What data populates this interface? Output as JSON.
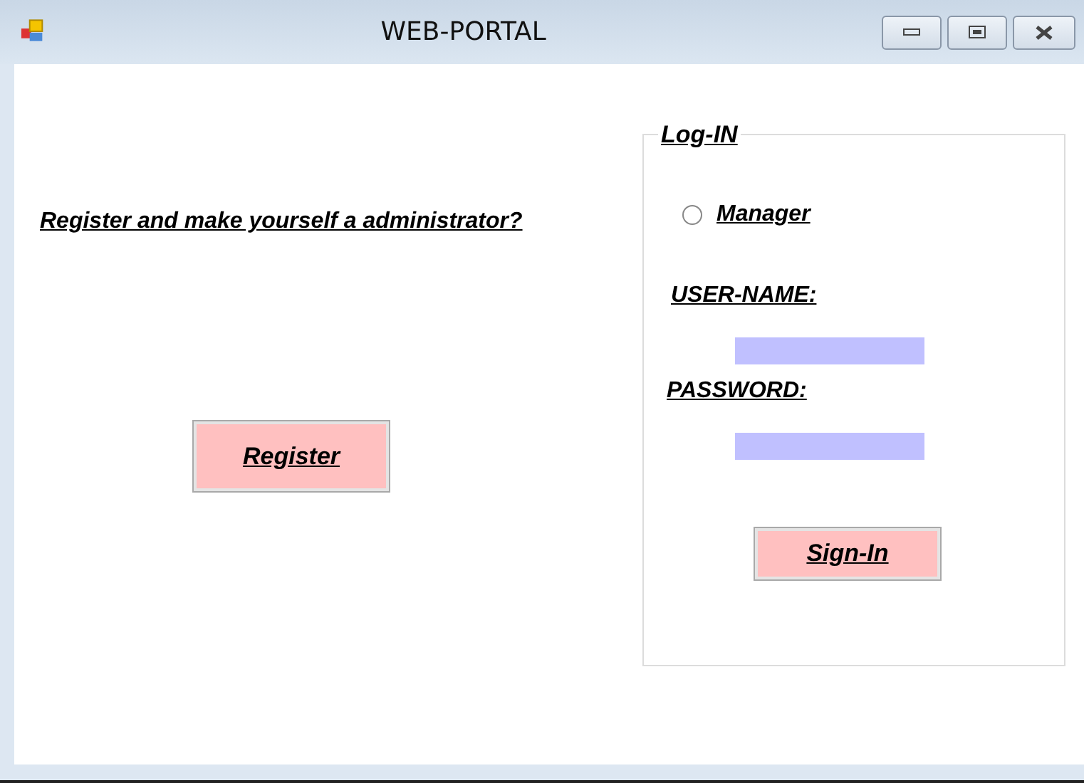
{
  "window": {
    "title": "WEB-PORTAL"
  },
  "register_prompt": "Register and make yourself a administrator?",
  "register_button": "Register",
  "login": {
    "title": "Log-IN",
    "role": {
      "label": "Manager",
      "selected": false
    },
    "fields": [
      {
        "label": "USER-NAME:"
      },
      {
        "label": "PASSWORD:"
      }
    ],
    "sign_in_button": "Sign-In"
  }
}
